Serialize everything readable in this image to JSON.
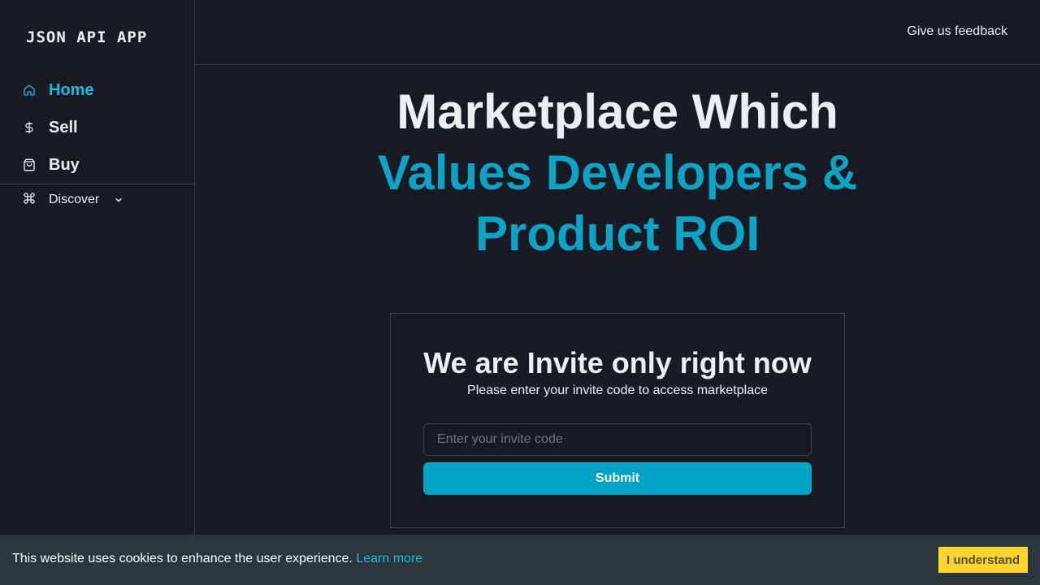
{
  "app": {
    "logo": "JSON API APP"
  },
  "sidebar": {
    "items": [
      {
        "label": "Home",
        "icon": "home-icon",
        "active": true
      },
      {
        "label": "Sell",
        "icon": "dollar-icon",
        "active": false
      },
      {
        "label": "Buy",
        "icon": "shopping-bag-icon",
        "active": false
      },
      {
        "label": "Discover",
        "icon": "command-icon",
        "active": false
      }
    ]
  },
  "header": {
    "feedback_label": "Give us feedback"
  },
  "hero": {
    "line1": "Marketplace Which",
    "line2": "Values Developers &",
    "line3": "Product ROI"
  },
  "invite": {
    "title": "We are Invite only right now",
    "subtitle": "Please enter your invite code to access marketplace",
    "input_placeholder": "Enter your invite code",
    "input_value": "",
    "submit_label": "Submit"
  },
  "cookie": {
    "text": "This website uses cookies to enhance the user experience.",
    "link_label": "Learn more",
    "button_label": "I understand"
  },
  "colors": {
    "background": "#181b23",
    "accent": "#0ea2c5",
    "nav_active": "#1eb8dc",
    "submit_bg": "#00a3c4",
    "cookie_bar": "#2b373d",
    "cookie_button": "#ffd42d"
  }
}
